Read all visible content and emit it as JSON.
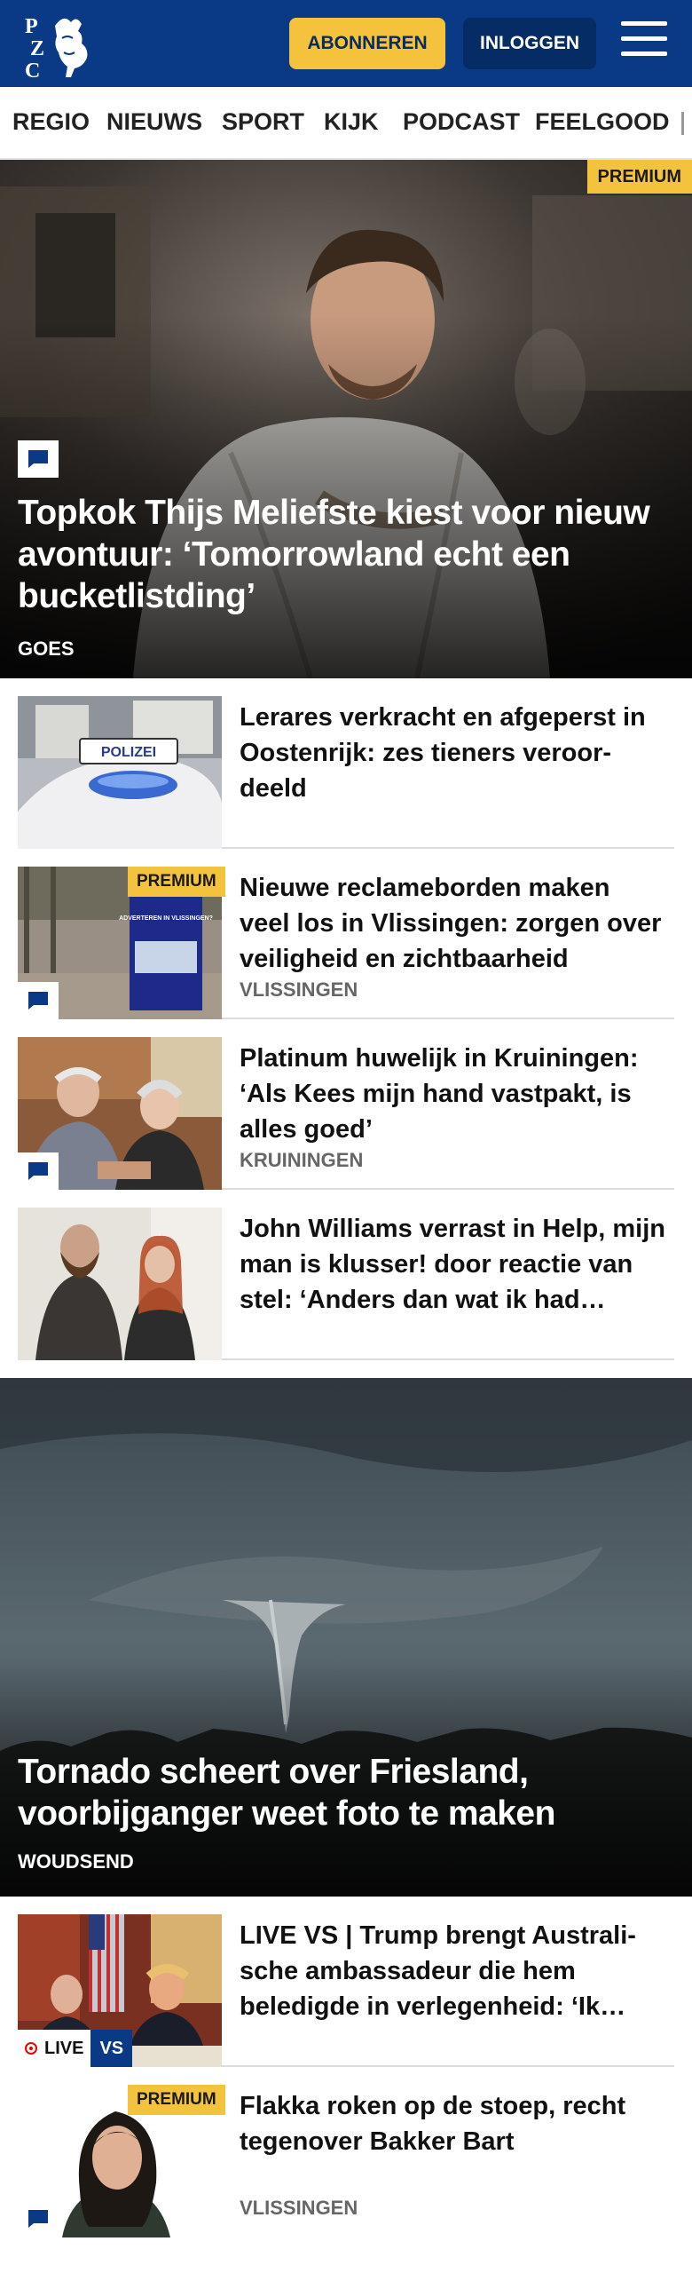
{
  "header": {
    "logo_letters": "PZC",
    "subscribe_label": "ABONNEREN",
    "login_label": "INLOGGEN"
  },
  "nav": {
    "items": [
      "REGIO",
      "NIEUWS",
      "SPORT",
      "KIJK",
      "PODCAST",
      "FEELGOOD"
    ]
  },
  "hero1": {
    "badge": "PREMIUM",
    "title": "Topkok Thijs Meliefste kiest voor nieuw avontuur: ‘Tomorrowland echt een bucketlistding’",
    "location": "GOES"
  },
  "articles1": [
    {
      "title": "Lerares verkracht en afgeperst in Oostenrijk: zes tieners veroor­deeld",
      "location": ""
    },
    {
      "title": "Nieuwe reclameborden maken veel los in Vlissingen: zorgen over veiligheid en zichtbaarheid",
      "location": "VLISSINGEN",
      "badge": "PREMIUM"
    },
    {
      "title": "Platinum huwelijk in Kruiningen: ‘Als Kees mijn hand vastpakt, is alles goed’",
      "location": "KRUININGEN"
    },
    {
      "title": "John Williams verrast in Help, mijn man is klusser! door reactie van stel: ‘Anders dan wat ik had…",
      "location": ""
    }
  ],
  "thumb_text": {
    "polizei": "POLIZEI",
    "billboard": "ADVERTEREN IN VLISSINGEN?"
  },
  "hero2": {
    "title": "Tornado scheert over Friesland, voorbijganger weet foto te maken",
    "location": "WOUDSEND"
  },
  "articles2": [
    {
      "title": "LIVE VS | Trump brengt Australi­sche ambassadeur die hem beledigde in verlegenheid: ‘Ik…",
      "live_label": "LIVE",
      "vs_label": "VS"
    },
    {
      "title": "Flakka roken op de stoep, recht tegenover Bakker Bart",
      "location": "VLISSINGEN",
      "badge": "PREMIUM"
    }
  ],
  "colors": {
    "brand_blue": "#0a3a85",
    "accent_yellow": "#f4c33d"
  }
}
